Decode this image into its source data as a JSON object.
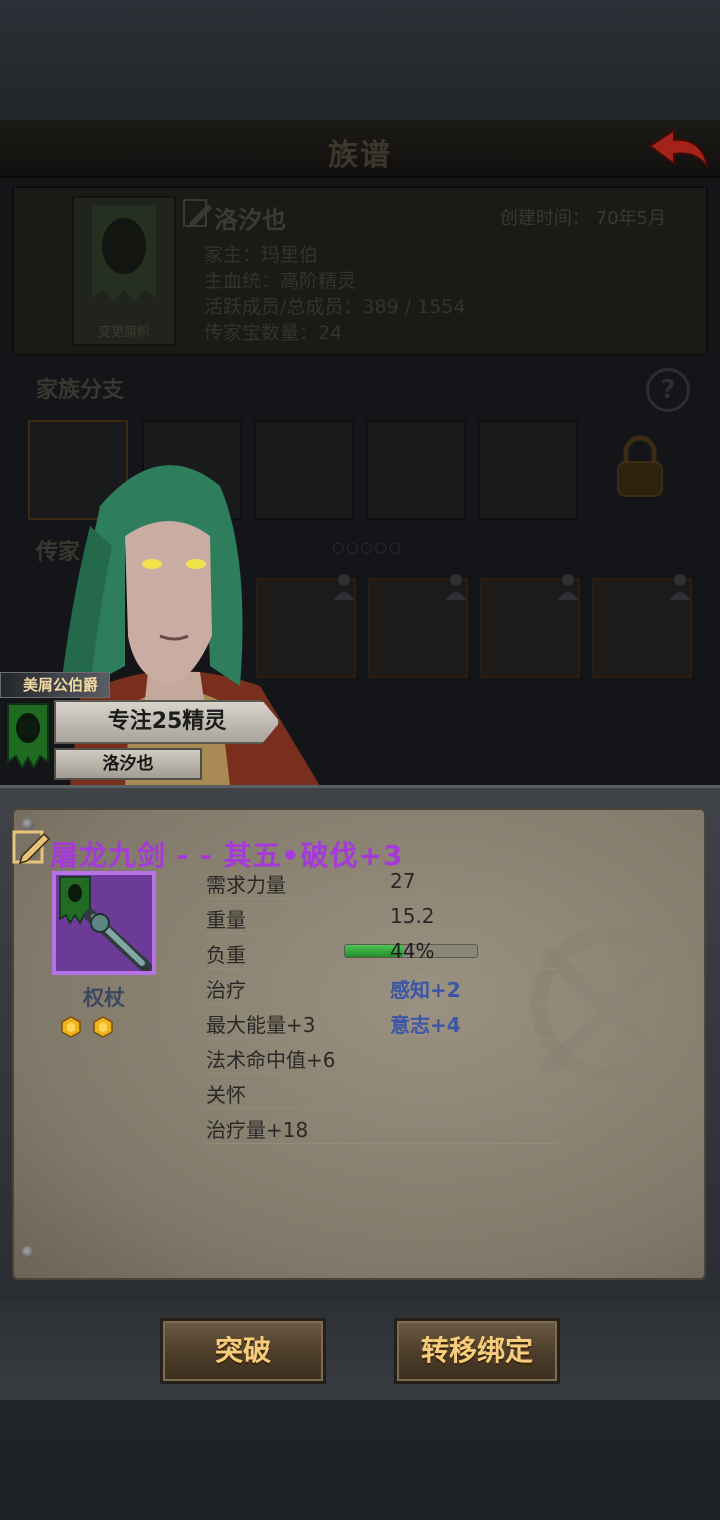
{
  "header": {
    "title": "族谱"
  },
  "family": {
    "crest_caption": "变更旗帜",
    "name": "洛汐也",
    "created": "创建时间： 70年5月",
    "head": "家主：玛里伯",
    "bloodline": "主血统：高阶精灵",
    "members": "活跃成员/总成员：389 / 1554",
    "treasures": "传家宝数量：24"
  },
  "branch": {
    "title": "家族分支"
  },
  "heirloom": {
    "title": "传家",
    "dots": "○○○○○"
  },
  "character": {
    "rank_title": "美屑公伯爵",
    "focus": "专注25精灵",
    "name": "洛汐也"
  },
  "item": {
    "title": "屠龙九剑 - - 其五•破伐+3",
    "type": "权杖",
    "gems": 2,
    "stats": [
      {
        "label": "需求力量",
        "value": "27"
      },
      {
        "label": "重量",
        "value": "15.2"
      },
      {
        "label": "负重",
        "value": "44%",
        "fraction": 0.44
      },
      {
        "label": "治疗",
        "value": "感知+2"
      },
      {
        "label": "最大能量+3",
        "value": "意志+4"
      },
      {
        "label": "法术命中值+6",
        "value": ""
      },
      {
        "label": "关怀",
        "value": ""
      },
      {
        "label": "治疗量+18",
        "value": ""
      }
    ]
  },
  "buttons": {
    "breakthrough": "突破",
    "transfer": "转移绑定"
  },
  "colors": {
    "item_title": "#a63ad8",
    "button_text": "#f7cd7c",
    "load_bar": "#3fb047"
  }
}
